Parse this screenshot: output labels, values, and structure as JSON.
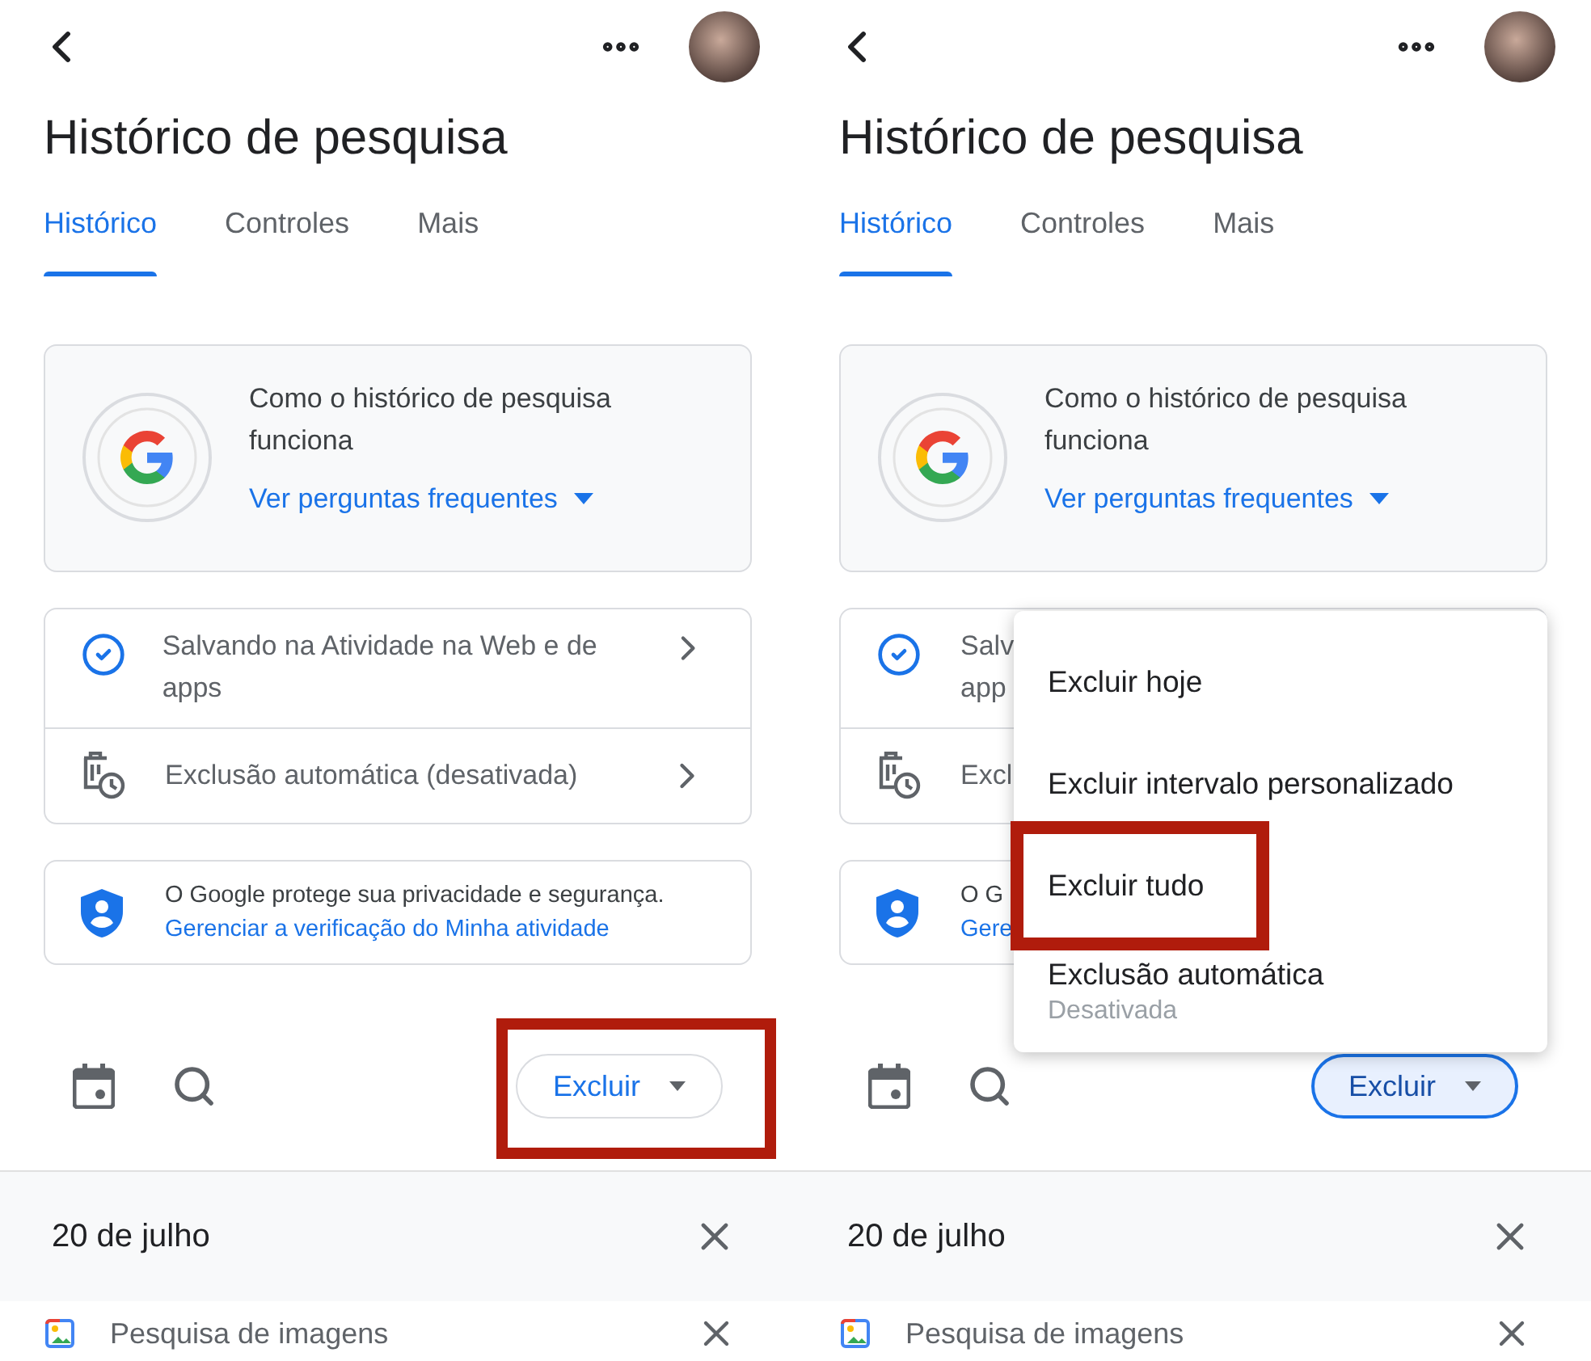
{
  "panels": [
    {
      "title": "Histórico de pesquisa",
      "tabs": [
        {
          "label": "Histórico",
          "selected": true
        },
        {
          "label": "Controles",
          "selected": false
        },
        {
          "label": "Mais",
          "selected": false
        }
      ],
      "info_card": {
        "title": "Como o histórico de pesquisa funciona",
        "link": "Ver perguntas frequentes"
      },
      "settings": [
        {
          "kind": "check",
          "text": "Salvando na Atividade na Web e de apps"
        },
        {
          "kind": "autodelete",
          "text": "Exclusão automática (desativada)"
        }
      ],
      "privacy": {
        "text": "O Google protege sua privacidade e segurança.",
        "link": "Gerenciar a verificação do Minha atividade"
      },
      "delete_button": {
        "label": "Excluir",
        "pressed": false,
        "highlighted": true
      },
      "date_header": "20 de julho",
      "result": "Pesquisa de imagens"
    },
    {
      "title": "Histórico de pesquisa",
      "tabs": [
        {
          "label": "Histórico",
          "selected": true
        },
        {
          "label": "Controles",
          "selected": false
        },
        {
          "label": "Mais",
          "selected": false
        }
      ],
      "info_card": {
        "title": "Como o histórico de pesquisa funciona",
        "link": "Ver perguntas frequentes"
      },
      "settings": [
        {
          "kind": "check",
          "text": "Salv app"
        },
        {
          "kind": "autodelete",
          "text": "Excl"
        }
      ],
      "privacy": {
        "text": "O G",
        "link": "Gere"
      },
      "delete_button": {
        "label": "Excluir",
        "pressed": true,
        "highlighted": false
      },
      "menu": [
        {
          "label": "Excluir hoje",
          "highlighted": false
        },
        {
          "label": "Excluir intervalo personalizado",
          "highlighted": false
        },
        {
          "label": "Excluir tudo",
          "highlighted": true
        },
        {
          "label": "Exclusão automática",
          "subtitle": "Desativada",
          "highlighted": false
        }
      ],
      "date_header": "20 de julho",
      "result": "Pesquisa de imagens"
    }
  ]
}
